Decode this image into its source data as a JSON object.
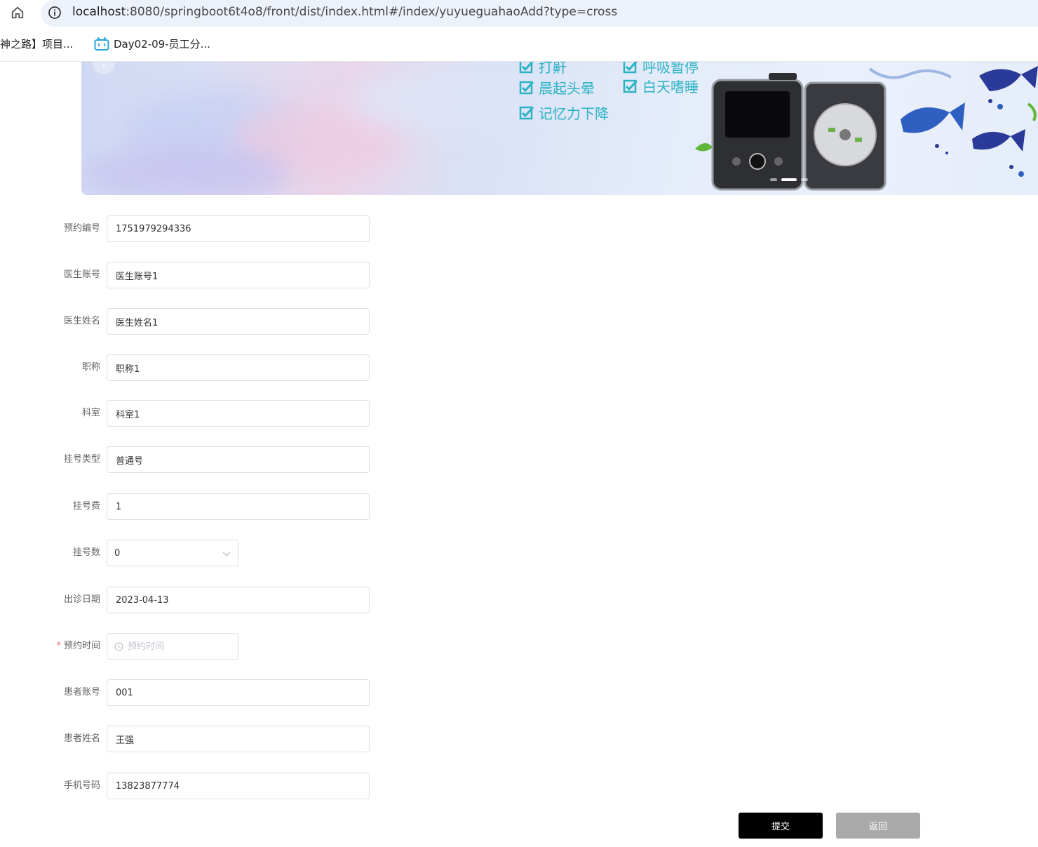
{
  "browser": {
    "url_host": "localhost",
    "url_path": ":8080/springboot6t4o8/front/dist/index.html#/index/yuyueguahaoAdd?type=cross",
    "bookmarks": [
      "神之路】项目...",
      "Day02-09-员工分..."
    ]
  },
  "banner": {
    "checks": [
      "打鼾",
      "呼吸暂停",
      "晨起头晕",
      "白天嗜睡",
      "记忆力下降"
    ],
    "slide_count": 3,
    "active_slide": 2,
    "accent_color": "#2bb3c4"
  },
  "form": {
    "fields": {
      "booking_no": {
        "label": "预约编号",
        "value": "1751979294336"
      },
      "doctor_account": {
        "label": "医生账号",
        "value": "医生账号1"
      },
      "doctor_name": {
        "label": "医生姓名",
        "value": "医生姓名1"
      },
      "title": {
        "label": "职称",
        "value": "职称1"
      },
      "department": {
        "label": "科室",
        "value": "科室1"
      },
      "reg_type": {
        "label": "挂号类型",
        "value": "普通号"
      },
      "reg_fee": {
        "label": "挂号费",
        "value": "1"
      },
      "reg_count": {
        "label": "挂号数",
        "value": "0"
      },
      "clinic_date": {
        "label": "出诊日期",
        "value": "2023-04-13"
      },
      "booking_time": {
        "label": "预约时间",
        "placeholder": "预约时间",
        "required_mark": "*"
      },
      "patient_account": {
        "label": "患者账号",
        "value": "001"
      },
      "patient_name": {
        "label": "患者姓名",
        "value": "王强"
      },
      "phone": {
        "label": "手机号码",
        "value": "13823877774"
      }
    },
    "buttons": {
      "submit": "提交",
      "back": "返回"
    }
  }
}
